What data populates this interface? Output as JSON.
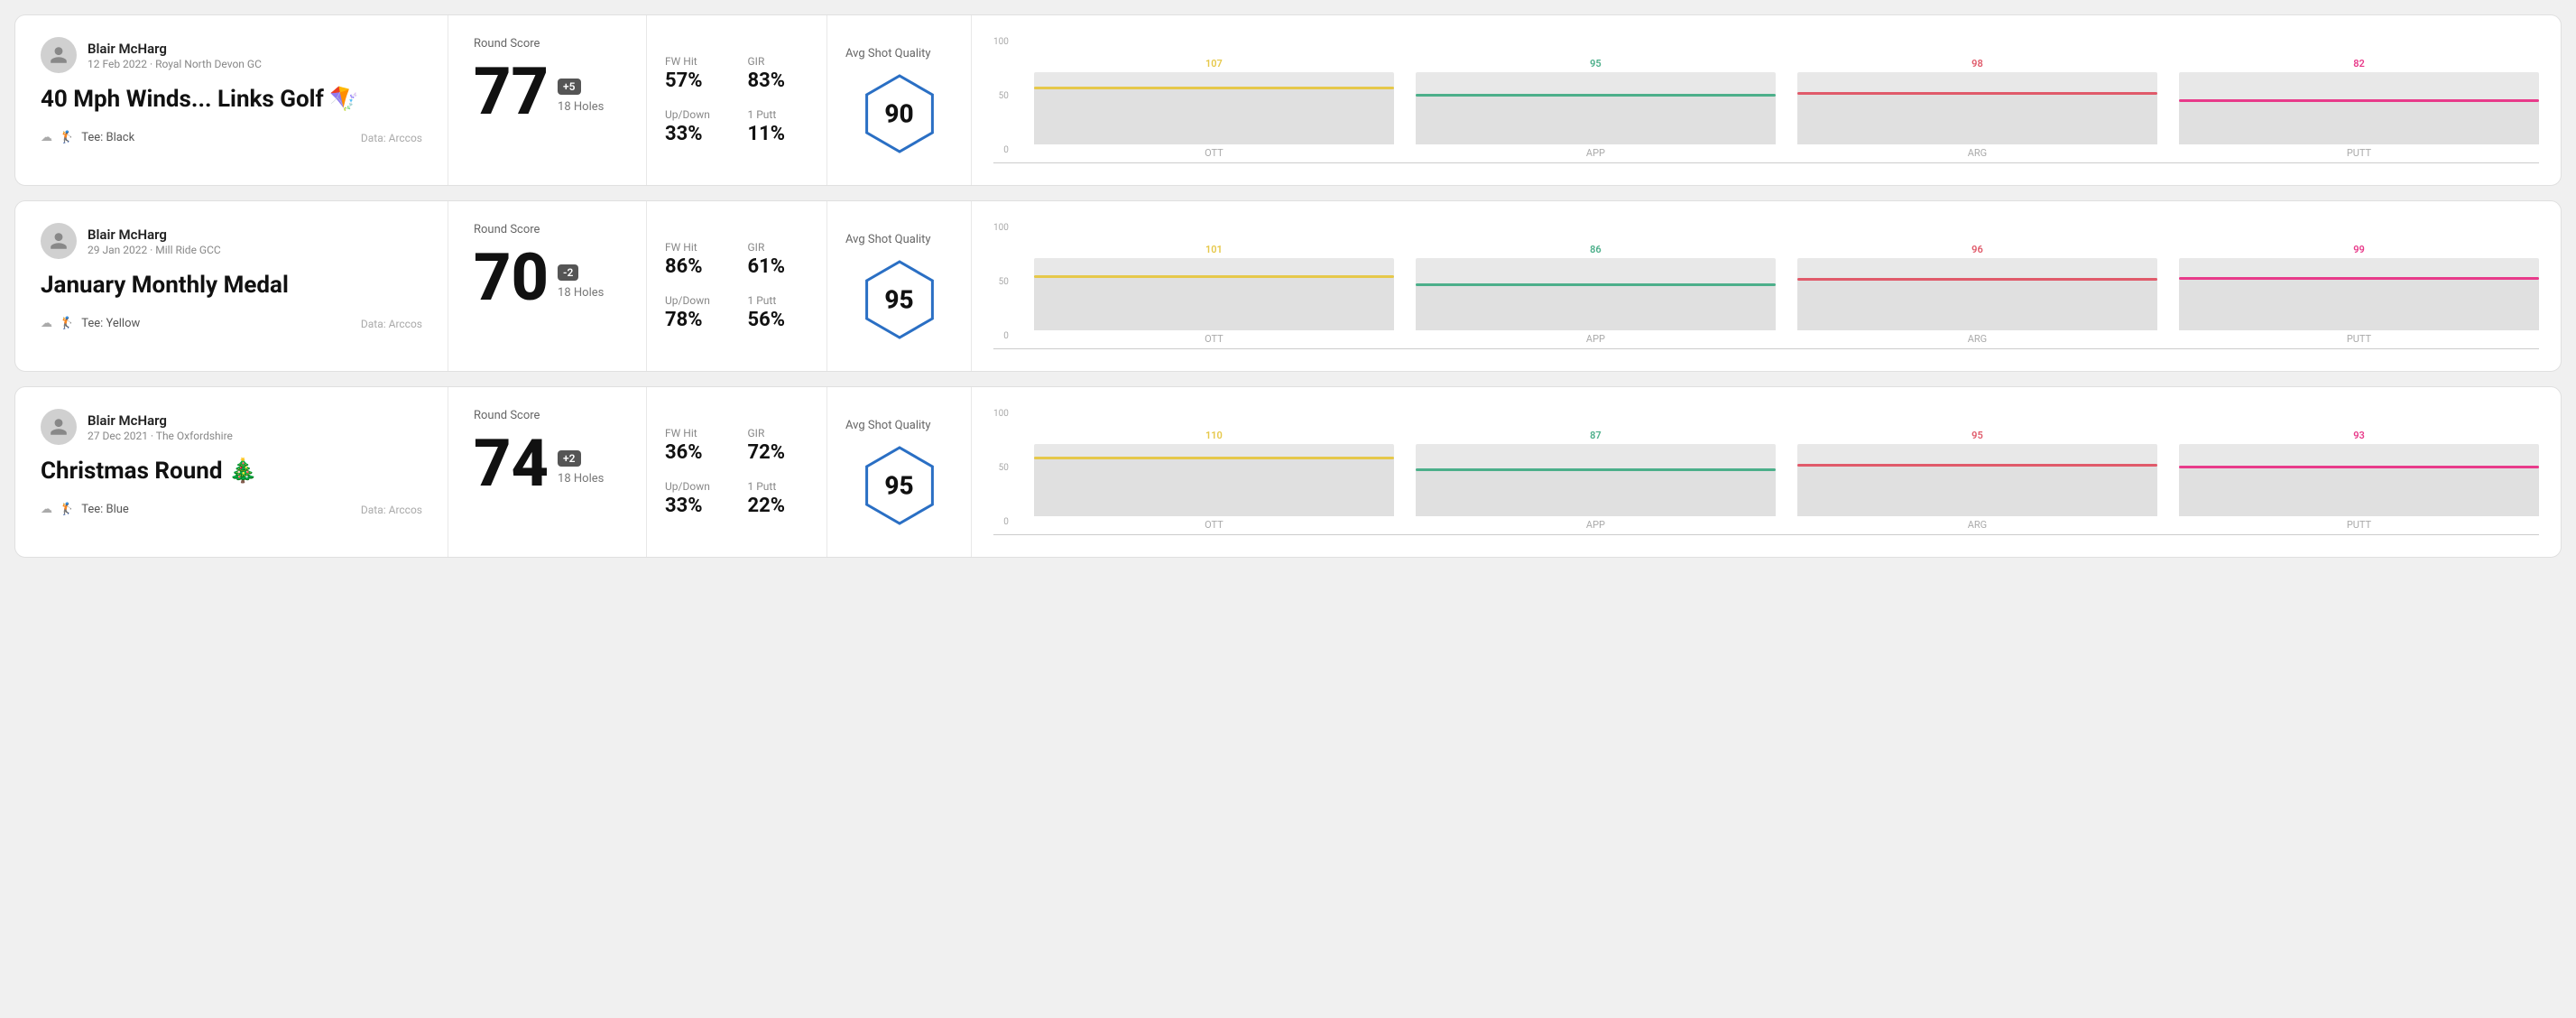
{
  "rounds": [
    {
      "id": "round-1",
      "player": {
        "name": "Blair McHarg",
        "date": "12 Feb 2022 · Royal North Devon GC"
      },
      "title": "40 Mph Winds... Links Golf 🪁",
      "tee": "Black",
      "dataSource": "Data: Arccos",
      "score": {
        "label": "Round Score",
        "value": "77",
        "badge": "+5",
        "holes": "18 Holes"
      },
      "stats": {
        "fwHit": {
          "label": "FW Hit",
          "value": "57%"
        },
        "gir": {
          "label": "GIR",
          "value": "83%"
        },
        "upDown": {
          "label": "Up/Down",
          "value": "33%"
        },
        "putt": {
          "label": "1 Putt",
          "value": "11%"
        }
      },
      "quality": {
        "label": "Avg Shot Quality",
        "value": "90"
      },
      "chart": {
        "bars": [
          {
            "label": "OTT",
            "value": 107,
            "color": "#e6c84a",
            "pct": 80
          },
          {
            "label": "APP",
            "value": 95,
            "color": "#4caf8a",
            "pct": 70
          },
          {
            "label": "ARG",
            "value": 98,
            "color": "#e05a6a",
            "pct": 73
          },
          {
            "label": "PUTT",
            "value": 82,
            "color": "#e83a8a",
            "pct": 62
          }
        ],
        "yLabels": [
          "100",
          "50",
          "0"
        ]
      }
    },
    {
      "id": "round-2",
      "player": {
        "name": "Blair McHarg",
        "date": "29 Jan 2022 · Mill Ride GCC"
      },
      "title": "January Monthly Medal",
      "tee": "Yellow",
      "dataSource": "Data: Arccos",
      "score": {
        "label": "Round Score",
        "value": "70",
        "badge": "-2",
        "holes": "18 Holes"
      },
      "stats": {
        "fwHit": {
          "label": "FW Hit",
          "value": "86%"
        },
        "gir": {
          "label": "GIR",
          "value": "61%"
        },
        "upDown": {
          "label": "Up/Down",
          "value": "78%"
        },
        "putt": {
          "label": "1 Putt",
          "value": "56%"
        }
      },
      "quality": {
        "label": "Avg Shot Quality",
        "value": "95"
      },
      "chart": {
        "bars": [
          {
            "label": "OTT",
            "value": 101,
            "color": "#e6c84a",
            "pct": 76
          },
          {
            "label": "APP",
            "value": 86,
            "color": "#4caf8a",
            "pct": 65
          },
          {
            "label": "ARG",
            "value": 96,
            "color": "#e05a6a",
            "pct": 72
          },
          {
            "label": "PUTT",
            "value": 99,
            "color": "#e83a8a",
            "pct": 74
          }
        ],
        "yLabels": [
          "100",
          "50",
          "0"
        ]
      }
    },
    {
      "id": "round-3",
      "player": {
        "name": "Blair McHarg",
        "date": "27 Dec 2021 · The Oxfordshire"
      },
      "title": "Christmas Round 🎄",
      "tee": "Blue",
      "dataSource": "Data: Arccos",
      "score": {
        "label": "Round Score",
        "value": "74",
        "badge": "+2",
        "holes": "18 Holes"
      },
      "stats": {
        "fwHit": {
          "label": "FW Hit",
          "value": "36%"
        },
        "gir": {
          "label": "GIR",
          "value": "72%"
        },
        "upDown": {
          "label": "Up/Down",
          "value": "33%"
        },
        "putt": {
          "label": "1 Putt",
          "value": "22%"
        }
      },
      "quality": {
        "label": "Avg Shot Quality",
        "value": "95"
      },
      "chart": {
        "bars": [
          {
            "label": "OTT",
            "value": 110,
            "color": "#e6c84a",
            "pct": 83
          },
          {
            "label": "APP",
            "value": 87,
            "color": "#4caf8a",
            "pct": 66
          },
          {
            "label": "ARG",
            "value": 95,
            "color": "#e05a6a",
            "pct": 72
          },
          {
            "label": "PUTT",
            "value": 93,
            "color": "#e83a8a",
            "pct": 70
          }
        ],
        "yLabels": [
          "100",
          "50",
          "0"
        ]
      }
    }
  ]
}
